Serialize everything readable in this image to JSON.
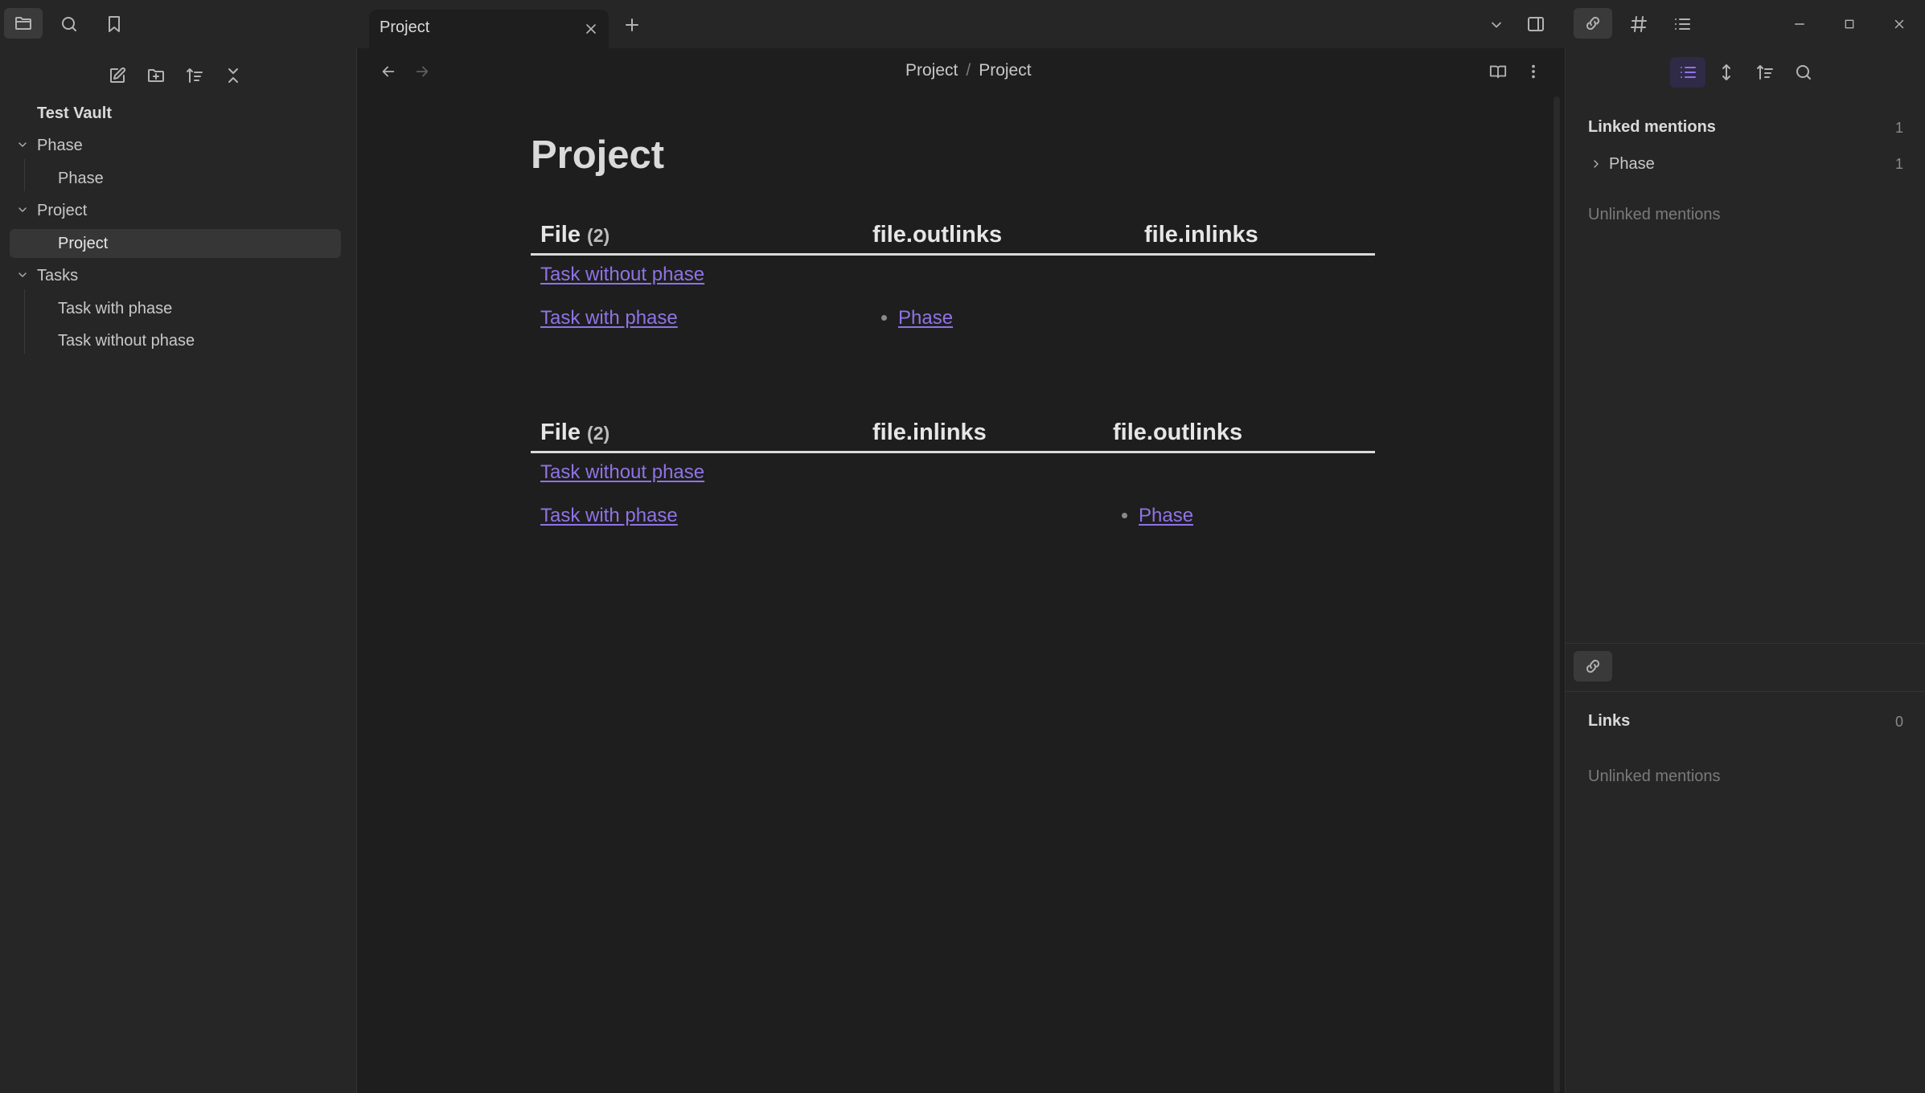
{
  "window": {
    "tab_title": "Project"
  },
  "sidebar": {
    "vault_name": "Test Vault",
    "tree": [
      {
        "label": "Phase",
        "type": "folder"
      },
      {
        "label": "Phase",
        "type": "file"
      },
      {
        "label": "Project",
        "type": "folder"
      },
      {
        "label": "Project",
        "type": "file",
        "selected": true
      },
      {
        "label": "Tasks",
        "type": "folder"
      },
      {
        "label": "Task with phase",
        "type": "file"
      },
      {
        "label": "Task without phase",
        "type": "file"
      }
    ]
  },
  "breadcrumb": {
    "parent": "Project",
    "separator": "/",
    "current": "Project"
  },
  "note": {
    "title": "Project",
    "table1": {
      "headers": [
        "File",
        "file.outlinks",
        "file.inlinks"
      ],
      "count": "(2)",
      "rows": [
        {
          "file": "Task without phase",
          "outlinks": "",
          "inlinks": ""
        },
        {
          "file": "Task with phase",
          "outlinks": "Phase",
          "inlinks": ""
        }
      ]
    },
    "table2": {
      "headers": [
        "File",
        "file.inlinks",
        "file.outlinks"
      ],
      "count": "(2)",
      "rows": [
        {
          "file": "Task without phase",
          "inlinks": "",
          "outlinks": ""
        },
        {
          "file": "Task with phase",
          "inlinks": "",
          "outlinks": "Phase"
        }
      ]
    }
  },
  "backlinks": {
    "linked_heading": "Linked mentions",
    "linked_count": "1",
    "linked_items": [
      {
        "label": "Phase",
        "count": "1"
      }
    ],
    "unlinked_heading": "Unlinked mentions"
  },
  "outgoing": {
    "links_heading": "Links",
    "links_count": "0",
    "unlinked_heading": "Unlinked mentions"
  },
  "colors": {
    "accent": "#8f73e6",
    "background": "#1e1e1e",
    "panel": "#262626"
  }
}
